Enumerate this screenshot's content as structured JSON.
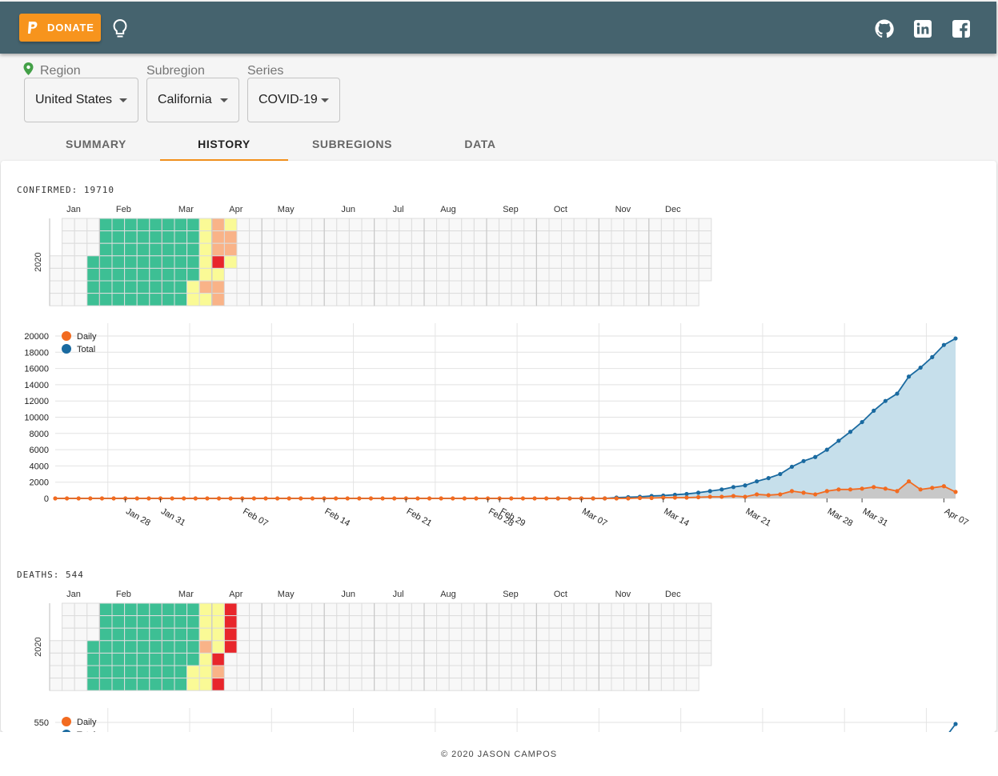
{
  "topbar": {
    "donate_label": "DONATE",
    "icons": [
      "paypal-icon",
      "lightbulb-icon",
      "github-icon",
      "linkedin-icon",
      "facebook-icon"
    ],
    "background": "#45636e",
    "accent": "#f7941d"
  },
  "selectors": {
    "region": {
      "label": "Region",
      "value": "United States"
    },
    "subregion": {
      "label": "Subregion",
      "value": "California"
    },
    "series": {
      "label": "Series",
      "value": "COVID-19"
    }
  },
  "tabs": [
    {
      "label": "SUMMARY",
      "active": false
    },
    {
      "label": "HISTORY",
      "active": true
    },
    {
      "label": "SUBREGIONS",
      "active": false
    },
    {
      "label": "DATA",
      "active": false
    }
  ],
  "sections": [
    {
      "label": "CONFIRMED: 19710"
    },
    {
      "label": "DEATHS: 544"
    }
  ],
  "footer": "© 2020 JASON CAMPOS",
  "chart_data": [
    {
      "type": "heatmap",
      "year_label": "2020",
      "month_labels": [
        "Jan",
        "Feb",
        "Mar",
        "Apr",
        "May",
        "Jun",
        "Jul",
        "Aug",
        "Sep",
        "Oct",
        "Nov",
        "Dec"
      ],
      "legend_colors": {
        "zero": "#3dbf94",
        "low": "#fafa96",
        "mid": "#f9b388",
        "high": "#e8262b",
        "none": "#f8f8f8"
      },
      "level_by_date": {
        "start_date": "2020-03-20",
        "levels": [
          1,
          1,
          1,
          1,
          1,
          1,
          1,
          2,
          1,
          2,
          2,
          2,
          3,
          1,
          2,
          2,
          1,
          2,
          2,
          1
        ]
      }
    },
    {
      "type": "area",
      "legend": [
        "Daily",
        "Total"
      ],
      "colors": {
        "Daily": "#f26b20",
        "Total": "#1a6aa0",
        "Total_fill": "#c6dfeb",
        "Daily_fill": "#c8c8c8"
      },
      "ylim": [
        0,
        20000
      ],
      "yticks": [
        0,
        2000,
        4000,
        6000,
        8000,
        10000,
        12000,
        14000,
        16000,
        18000,
        20000
      ],
      "xtick_labels": [
        "Jan 28",
        "Jan 31",
        "Feb 07",
        "Feb 14",
        "Feb 21",
        "Feb 28",
        "Feb 29",
        "Mar 07",
        "Mar 14",
        "Mar 21",
        "Mar 28",
        "Mar 31",
        "Apr 07"
      ],
      "x_dates_first": "2020-01-22",
      "x_dates_last": "2020-04-08",
      "total_tail": [
        0,
        0,
        0,
        0,
        0,
        0,
        0,
        0,
        0,
        0,
        0,
        0,
        0,
        100,
        150,
        200,
        300,
        350,
        450,
        550,
        700,
        900,
        1100,
        1400,
        1600,
        2100,
        2500,
        3000,
        3900,
        4600,
        5100,
        6000,
        7100,
        8200,
        9400,
        10800,
        12000,
        12900,
        15000,
        16100,
        17400,
        18900,
        19700
      ],
      "daily_tail": [
        0,
        0,
        0,
        0,
        0,
        0,
        0,
        0,
        0,
        0,
        0,
        0,
        0,
        0,
        0,
        50,
        50,
        100,
        100,
        100,
        150,
        200,
        200,
        300,
        200,
        500,
        400,
        500,
        900,
        700,
        500,
        900,
        1100,
        1100,
        1200,
        1400,
        1200,
        900,
        2100,
        1100,
        1300,
        1500,
        800
      ]
    },
    {
      "type": "heatmap",
      "year_label": "2020",
      "month_labels": [
        "Jan",
        "Feb",
        "Mar",
        "Apr",
        "May",
        "Jun",
        "Jul",
        "Aug",
        "Sep",
        "Oct",
        "Nov",
        "Dec"
      ],
      "level_by_date": {
        "start_date": "2020-03-20",
        "levels": [
          1,
          1,
          1,
          1,
          1,
          2,
          1,
          1,
          1,
          1,
          1,
          1,
          1,
          3,
          2,
          3,
          3,
          3,
          3,
          3
        ]
      }
    },
    {
      "type": "area",
      "legend": [
        "Daily",
        "Total"
      ],
      "ytick_top": 550
    }
  ]
}
